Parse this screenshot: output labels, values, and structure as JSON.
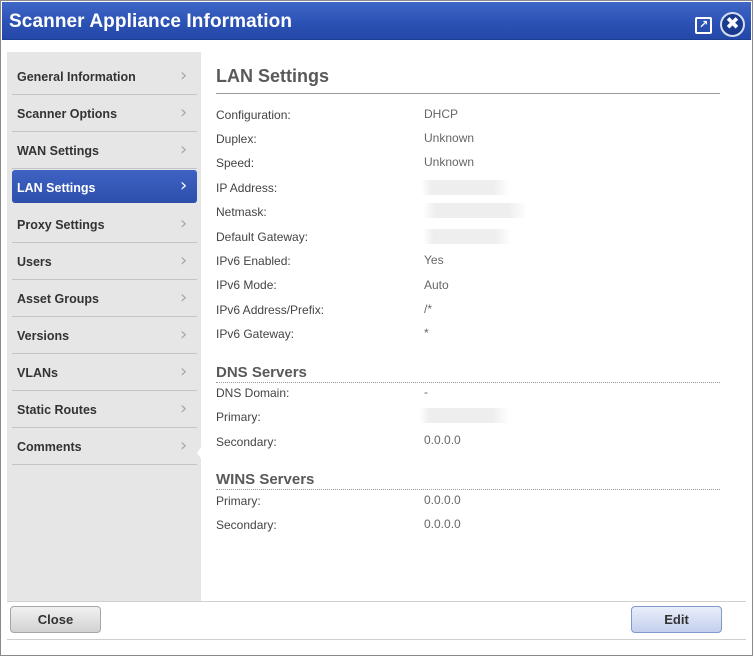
{
  "window": {
    "title": "Scanner Appliance Information",
    "popout_glyph": "↗",
    "close_glyph": "✖"
  },
  "sidebar": {
    "chevron_glyph": "›",
    "items": [
      {
        "label": "General Information",
        "active": false
      },
      {
        "label": "Scanner Options",
        "active": false
      },
      {
        "label": "WAN Settings",
        "active": false
      },
      {
        "label": "LAN Settings",
        "active": true
      },
      {
        "label": "Proxy Settings",
        "active": false
      },
      {
        "label": "Users",
        "active": false
      },
      {
        "label": "Asset Groups",
        "active": false
      },
      {
        "label": "Versions",
        "active": false
      },
      {
        "label": "VLANs",
        "active": false
      },
      {
        "label": "Static Routes",
        "active": false
      },
      {
        "label": "Comments",
        "active": false
      }
    ]
  },
  "main": {
    "section_title": "LAN Settings",
    "lan_rows": [
      {
        "label": "Configuration:",
        "value": "DHCP"
      },
      {
        "label": "Duplex:",
        "value": "Unknown"
      },
      {
        "label": "Speed:",
        "value": "Unknown"
      },
      {
        "label": "IP Address:",
        "value": ""
      },
      {
        "label": "Netmask:",
        "value": ""
      },
      {
        "label": "Default Gateway:",
        "value": ""
      },
      {
        "label": "IPv6 Enabled:",
        "value": "Yes"
      },
      {
        "label": "IPv6 Mode:",
        "value": "Auto"
      },
      {
        "label": "IPv6 Address/Prefix:",
        "value": "/*"
      },
      {
        "label": "IPv6 Gateway:",
        "value": "*"
      }
    ],
    "dns": {
      "heading": "DNS Servers",
      "rows": [
        {
          "label": "DNS Domain:",
          "value": "-"
        },
        {
          "label": "Primary:",
          "value": ""
        },
        {
          "label": "Secondary:",
          "value": "0.0.0.0"
        }
      ]
    },
    "wins": {
      "heading": "WINS Servers",
      "rows": [
        {
          "label": "Primary:",
          "value": "0.0.0.0"
        },
        {
          "label": "Secondary:",
          "value": "0.0.0.0"
        }
      ]
    }
  },
  "footer": {
    "close_label": "Close",
    "edit_label": "Edit"
  },
  "colors": {
    "titlebar": "#2b52b5",
    "active_nav": "#3456b8",
    "sidebar_bg": "#e6e6e6"
  }
}
